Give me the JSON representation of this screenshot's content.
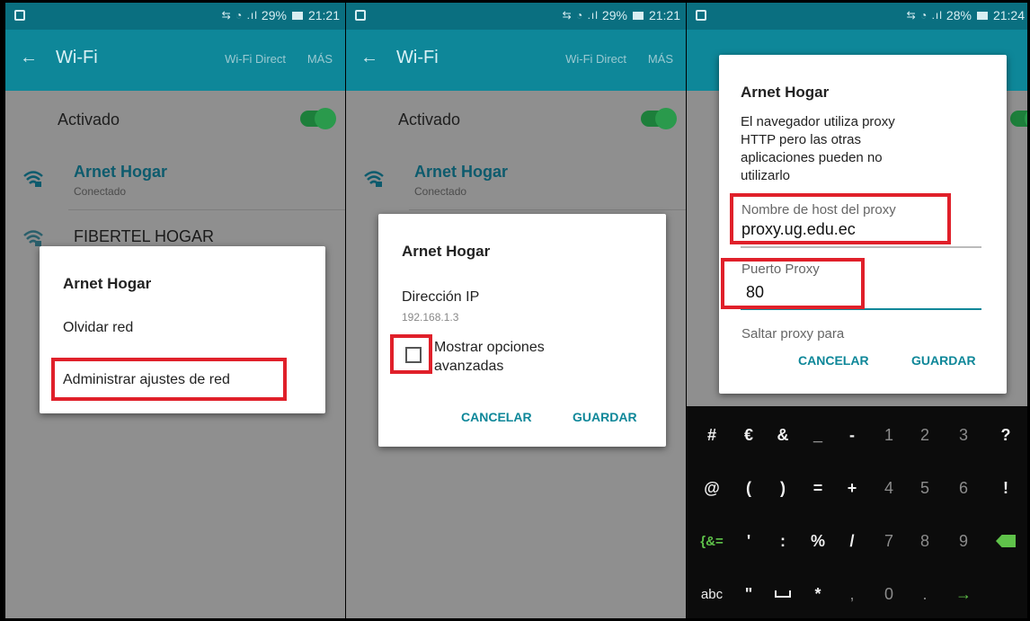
{
  "screens": [
    {
      "status": {
        "signal": "⇆ ◔ .ıl",
        "battery": "29%",
        "time": "21:21"
      },
      "appbar": {
        "back": "←",
        "title": "Wi-Fi",
        "wifi_direct": "Wi-Fi Direct",
        "more": "MÁS"
      },
      "activado": "Activado",
      "networks": [
        {
          "name": "Arnet Hogar",
          "status": "Conectado"
        },
        {
          "name": "FIBERTEL HOGAR",
          "status": ""
        }
      ],
      "dialog": {
        "title": "Arnet Hogar",
        "forget": "Olvidar red",
        "manage": "Administrar ajustes de red"
      }
    },
    {
      "status": {
        "signal": "⇆ ◔ .ıl",
        "battery": "29%",
        "time": "21:21"
      },
      "appbar": {
        "back": "←",
        "title": "Wi-Fi",
        "wifi_direct": "Wi-Fi Direct",
        "more": "MÁS"
      },
      "activado": "Activado",
      "networks": [
        {
          "name": "Arnet Hogar",
          "status": "Conectado"
        }
      ],
      "dialog": {
        "title": "Arnet Hogar",
        "ip_label": "Dirección IP",
        "ip_value": "192.168.1.3",
        "advanced_line1": "Mostrar opciones",
        "advanced_line2": "avanzadas",
        "cancel": "CANCELAR",
        "save": "GUARDAR"
      }
    },
    {
      "status": {
        "signal": "⇆ ◔ .ıl",
        "battery": "28%",
        "time": "21:24"
      },
      "dialog": {
        "title": "Arnet Hogar",
        "info_lines": [
          "El navegador utiliza proxy",
          "HTTP pero las otras",
          "aplicaciones pueden no",
          "utilizarlo"
        ],
        "host_label": "Nombre de host del proxy",
        "host_value": "proxy.ug.edu.ec",
        "port_label": "Puerto Proxy",
        "port_value": "80",
        "bypass_label": "Saltar proxy para",
        "cancel": "CANCELAR",
        "save": "GUARDAR"
      },
      "keyboard": {
        "rows": [
          [
            "#",
            "€",
            "&",
            "_",
            "-",
            "1",
            "2",
            "3",
            "?"
          ],
          [
            "@",
            "(",
            ")",
            "=",
            "+",
            "4",
            "5",
            "6",
            "!"
          ],
          [
            "{&=",
            "'",
            ":",
            "%",
            "/",
            "7",
            "8",
            "9",
            ""
          ],
          [
            "abc",
            "\"",
            "",
            "*",
            ",",
            "0",
            ".",
            "→",
            ""
          ]
        ]
      }
    }
  ],
  "colors": {
    "accent": "#0e8799",
    "highlight": "#e0202a",
    "toggle": "#2a9a4c"
  }
}
